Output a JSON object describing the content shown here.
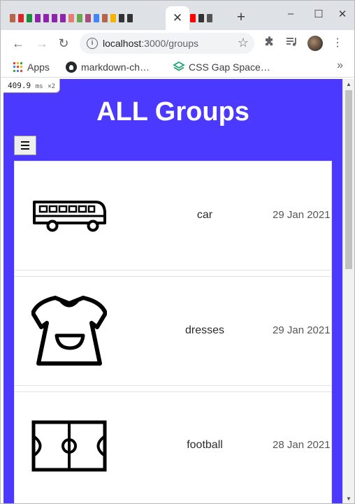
{
  "browser": {
    "tab_close_glyph": "✕",
    "new_tab_glyph": "+",
    "window_controls": {
      "minimize": "–",
      "maximize": "☐",
      "close": "✕"
    },
    "nav": {
      "back": "←",
      "forward": "→",
      "reload": "↻"
    },
    "url_host": "localhost",
    "url_rest": ":3000/groups",
    "star_glyph": "☆",
    "menu_glyph": "⋮",
    "bookmarks": [
      {
        "label": "Apps",
        "icon": "apps-grid-icon"
      },
      {
        "label": "markdown-ch…",
        "icon": "github-icon"
      },
      {
        "label": "CSS Gap Space…",
        "icon": "css-layers-icon"
      }
    ],
    "bookmarks_more": "»"
  },
  "perf": {
    "value": "409.9",
    "unit": "ms",
    "scale": "×2"
  },
  "page": {
    "title": "ALL Groups",
    "accent_color": "#4b39ff"
  },
  "groups": [
    {
      "name": "car",
      "date": "29 Jan 2021",
      "icon": "bus-icon"
    },
    {
      "name": "dresses",
      "date": "29 Jan 2021",
      "icon": "dress-icon"
    },
    {
      "name": "football",
      "date": "28 Jan 2021",
      "icon": "football-pitch-icon"
    }
  ]
}
